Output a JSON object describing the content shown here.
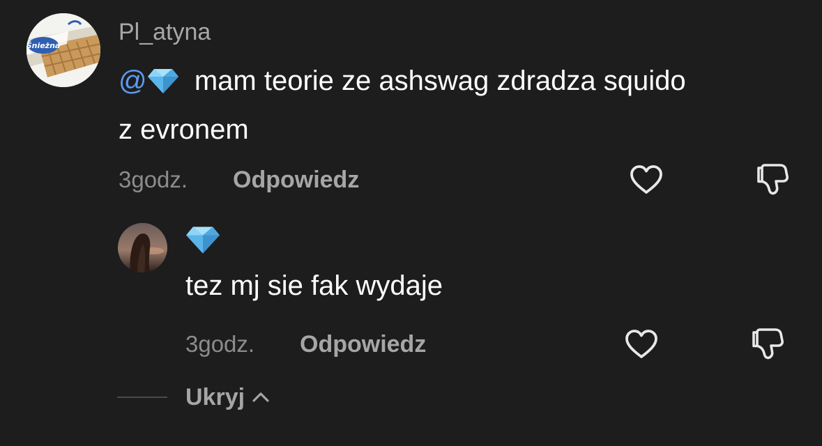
{
  "comment": {
    "username": "Pl_atyna",
    "mention": "@",
    "mention_icon": "diamond-emoji",
    "text_line1": "mam teorie ze ashswag zdradza squido",
    "text_line2": "z evronem",
    "time": "3godz.",
    "reply_label": "Odpowiedz",
    "avatar_brand": "Śnieżna"
  },
  "reply": {
    "username_icon": "diamond-emoji",
    "text": "tez mj sie fak wydaje",
    "time": "3godz.",
    "reply_label": "Odpowiedz"
  },
  "thread": {
    "hide_label": "Ukryj"
  },
  "colors": {
    "background": "#1d1d1d",
    "mention": "#5b9cf0",
    "muted_text": "#8c8c8c",
    "action_text": "#a6a6a6",
    "gem": "#6fc3f2"
  }
}
